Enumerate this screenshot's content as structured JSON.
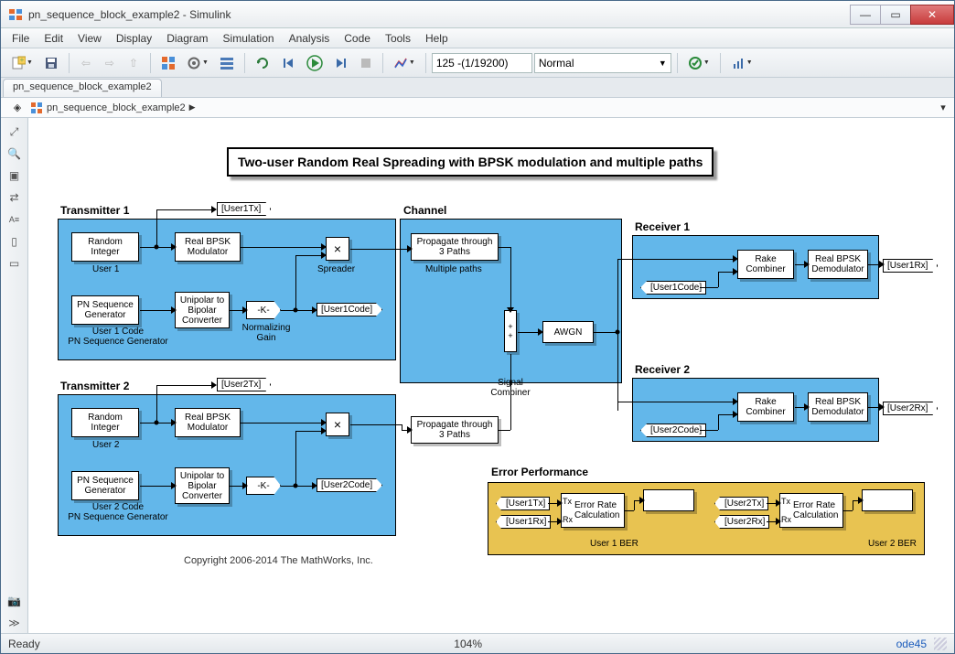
{
  "window": {
    "title": "pn_sequence_block_example2 - Simulink"
  },
  "menu": [
    "File",
    "Edit",
    "View",
    "Display",
    "Diagram",
    "Simulation",
    "Analysis",
    "Code",
    "Tools",
    "Help"
  ],
  "toolbar": {
    "stop_time": "125 -(1/19200)",
    "mode": "Normal"
  },
  "tabs": [
    "pn_sequence_block_example2"
  ],
  "breadcrumb": {
    "model": "pn_sequence_block_example2"
  },
  "model_title": "Two-user Random Real Spreading with BPSK modulation and multiple paths",
  "tx1": {
    "label": "Transmitter 1",
    "rand": "Random\nInteger",
    "rand_sub": "User 1",
    "mod": "Real BPSK\nModulator",
    "spreader": "×",
    "spreader_sub": "Spreader",
    "pn": "PN Sequence\nGenerator",
    "pn_sub": "User 1 Code\nPN Sequence Generator",
    "unibi": "Unipolar to\nBipolar\nConverter",
    "gain": "-K-",
    "gain_sub": "Normalizing\nGain",
    "goto_tx": "[User1Tx]",
    "goto_code": "[User1Code]"
  },
  "tx2": {
    "label": "Transmitter 2",
    "rand": "Random\nInteger",
    "rand_sub": "User 2",
    "mod": "Real BPSK\nModulator",
    "spreader": "×",
    "pn": "PN Sequence\nGenerator",
    "pn_sub": "User 2 Code\nPN Sequence Generator",
    "unibi": "Unipolar to\nBipolar\nConverter",
    "gain": "-K-",
    "goto_tx": "[User2Tx]",
    "goto_code": "[User2Code]"
  },
  "channel": {
    "label": "Channel",
    "prop": "Propagate through\n3 Paths",
    "prop_sub": "Multiple paths",
    "sum": "+ +",
    "sum_sub": "Signal\nCombiner",
    "awgn": "AWGN"
  },
  "rx1": {
    "label": "Receiver 1",
    "from_code": "[User1Code]",
    "rake": "Rake\nCombiner",
    "demod": "Real BPSK\nDemodulator",
    "goto_rx": "[User1Rx]"
  },
  "rx2": {
    "label": "Receiver 2",
    "from_code": "[User2Code]",
    "rake": "Rake\nCombiner",
    "demod": "Real BPSK\nDemodulator",
    "goto_rx": "[User2Rx]"
  },
  "err": {
    "label": "Error Performance",
    "u1tx": "[User1Tx]",
    "u1rx": "[User1Rx]",
    "u2tx": "[User2Tx]",
    "u2rx": "[User2Rx]",
    "erc": "Error Rate\nCalculation",
    "tx_pin": "Tx",
    "rx_pin": "Rx",
    "u1_sub": "User 1 BER",
    "u2_sub": "User 2 BER"
  },
  "copyright": "Copyright 2006-2014 The MathWorks, Inc.",
  "status": {
    "ready": "Ready",
    "zoom": "104%",
    "solver": "ode45"
  }
}
